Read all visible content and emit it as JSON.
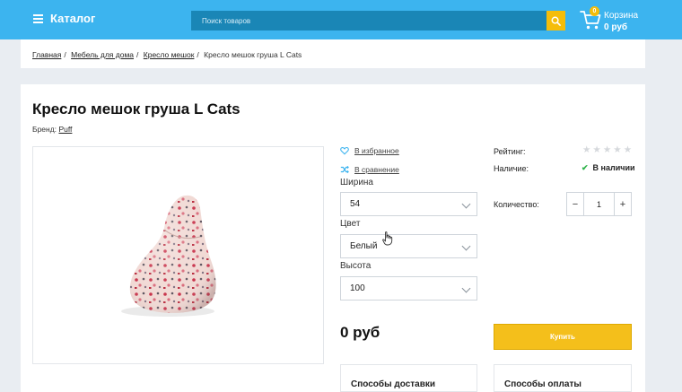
{
  "header": {
    "catalog_label": "Каталог",
    "search_placeholder": "Поиск товаров",
    "cart_count": "0",
    "cart_label": "Корзина",
    "cart_total": "0 руб"
  },
  "breadcrumb": {
    "items": [
      "Главная",
      "Мебель для дома",
      "Кресло мешок"
    ],
    "current": "Кресло мешок груша L Cats"
  },
  "product": {
    "title": "Кресло мешок груша L Cats",
    "brand_label": "Бренд:",
    "brand_name": "Puff",
    "favorite_label": "В избранное",
    "compare_label": "В сравнение",
    "options": [
      {
        "label": "Ширина",
        "value": "54"
      },
      {
        "label": "Цвет",
        "value": "Белый"
      },
      {
        "label": "Высота",
        "value": "100"
      }
    ],
    "price": "0 руб",
    "rating_label": "Рейтинг:",
    "rating_value": 0,
    "rating_max": 5,
    "availability_label": "Наличие:",
    "availability_value": "В наличии",
    "quantity_label": "Количество:",
    "quantity_value": "1",
    "buy_label": "Купить",
    "delivery_title": "Способы доставки",
    "payment_title": "Способы оплаты"
  },
  "colors": {
    "header_bg": "#3cb4ef",
    "search_bg": "#1a86b6",
    "accent": "#f5bd0a",
    "in_stock": "#2fb34a"
  }
}
